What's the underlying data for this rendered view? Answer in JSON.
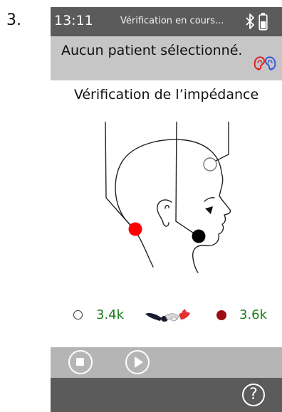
{
  "step_label": "3.",
  "statusbar": {
    "time": "13:11",
    "title": "Vérification en cours...",
    "icons": [
      "bluetooth-icon",
      "battery-icon"
    ]
  },
  "patient": {
    "text": "Aucun patient sélectionné.",
    "ear_icons": [
      "left-ear-icon",
      "right-ear-icon"
    ]
  },
  "main": {
    "heading": "Vérification de l’impédance"
  },
  "readings": {
    "left_value": "3.4k",
    "right_value": "3.6k"
  },
  "controls": {
    "buttons": [
      "stop-icon",
      "play-icon"
    ]
  },
  "help": {
    "label": "?"
  },
  "colors": {
    "bar_dark": "#5b5b5b",
    "bar_light": "#c6c6c6",
    "control_bar": "#b5b5b5",
    "value_green": "#1a7d1a",
    "electrode_red": "#ff0000",
    "electrode_black": "#000000",
    "right_indicator": "#9b0d12"
  }
}
